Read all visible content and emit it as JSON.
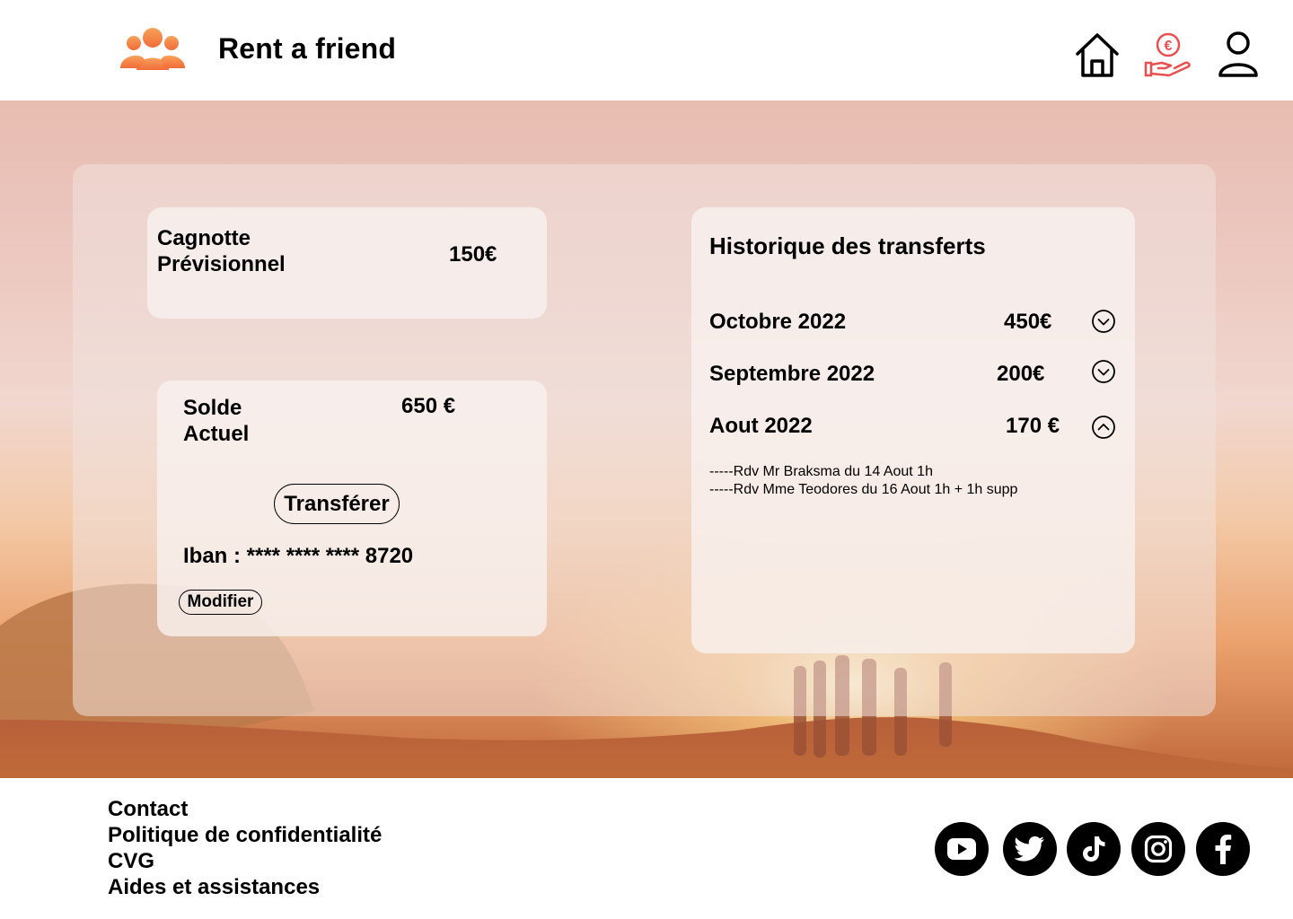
{
  "header": {
    "app_title": "Rent a friend",
    "icons": [
      "users-group-icon",
      "home-icon",
      "euro-hand-icon",
      "user-icon"
    ]
  },
  "colors": {
    "accent": "#f26b3a",
    "accent_light": "#f7a25a",
    "active_nav": "#ea4f4f"
  },
  "cagnotte": {
    "label_line1": "Cagnotte",
    "label_line2": "Prévisionnel",
    "amount": "150€"
  },
  "solde": {
    "label_line1": "Solde",
    "label_line2": "Actuel",
    "amount": "650 €",
    "transfer_button": "Transférer",
    "iban": "Iban : **** **** **** 8720",
    "modify_button": "Modifier"
  },
  "history": {
    "title": "Historique des transferts",
    "rows": [
      {
        "month": "Octobre 2022",
        "amount": "450€",
        "expanded": false
      },
      {
        "month": "Septembre 2022",
        "amount": "200€",
        "expanded": false
      },
      {
        "month": "Aout 2022",
        "amount": "170 €",
        "expanded": true
      }
    ],
    "details": [
      "-----Rdv Mr Braksma du 14 Aout 1h",
      "-----Rdv Mme Teodores du 16 Aout 1h + 1h supp"
    ]
  },
  "footer": {
    "links": [
      "Contact",
      "Politique de confidentialité",
      "CVG",
      "Aides et assistances"
    ],
    "social": [
      "youtube-icon",
      "twitter-icon",
      "tiktok-icon",
      "instagram-icon",
      "facebook-icon"
    ]
  }
}
